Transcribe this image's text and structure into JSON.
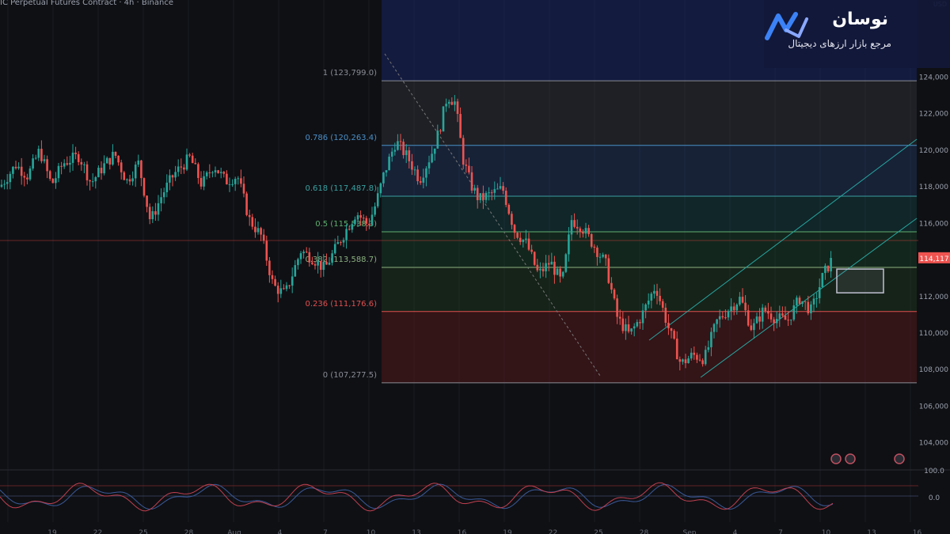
{
  "header": {
    "symbol_text": "IC Perpetual Futures Contract · 4h · Binance"
  },
  "brand": {
    "title": "نوسان",
    "subtitle": "مرجع بازار ارزهای دیجیتال"
  },
  "colors": {
    "up": "#26a69a",
    "down": "#ef5350",
    "bg": "#0f1014"
  },
  "chart_data": {
    "type": "candlestick",
    "currency_label": "USD",
    "y_ticks": [
      "124,000",
      "122,000",
      "120,000",
      "118,000",
      "116,000",
      "114,000",
      "112,000",
      "110,000",
      "108,000",
      "106,000",
      "104,000"
    ],
    "y_tick_values": [
      124000,
      122000,
      120000,
      118000,
      116000,
      114000,
      112000,
      110000,
      108000,
      106000,
      104000
    ],
    "ylim": [
      102600,
      126400
    ],
    "last_price": {
      "label": "114,117",
      "value": 114117
    },
    "fibonacci": [
      {
        "label": "1 (123,799.0)",
        "value": 123799.0
      },
      {
        "label": "0.786 (120,263.4)",
        "value": 120263.4
      },
      {
        "label": "0.618 (117,487.8)",
        "value": 117487.8
      },
      {
        "label": "0.5 (115,538.3)",
        "value": 115538.3
      },
      {
        "label": "0.382 (113,588.7)",
        "value": 113588.7
      },
      {
        "label": "0.236 (111,176.6)",
        "value": 111176.6
      },
      {
        "label": "0 (107,277.5)",
        "value": 107277.5
      }
    ],
    "close_path": [
      [
        0,
        118000
      ],
      [
        20,
        119200
      ],
      [
        35,
        118600
      ],
      [
        50,
        120000
      ],
      [
        65,
        118100
      ],
      [
        80,
        119300
      ],
      [
        100,
        119700
      ],
      [
        115,
        118200
      ],
      [
        130,
        119100
      ],
      [
        145,
        119800
      ],
      [
        160,
        118300
      ],
      [
        175,
        119300
      ],
      [
        190,
        116100
      ],
      [
        205,
        117600
      ],
      [
        220,
        118700
      ],
      [
        240,
        119600
      ],
      [
        255,
        118100
      ],
      [
        270,
        119200
      ],
      [
        285,
        118300
      ],
      [
        300,
        118600
      ],
      [
        315,
        116200
      ],
      [
        330,
        115300
      ],
      [
        345,
        112600
      ],
      [
        360,
        112100
      ],
      [
        380,
        114500
      ],
      [
        395,
        114100
      ],
      [
        410,
        113500
      ],
      [
        430,
        115100
      ],
      [
        450,
        116600
      ],
      [
        465,
        115900
      ],
      [
        475,
        117100
      ],
      [
        485,
        118700
      ],
      [
        500,
        120500
      ],
      [
        515,
        119600
      ],
      [
        530,
        118400
      ],
      [
        545,
        119800
      ],
      [
        555,
        121100
      ],
      [
        565,
        123000
      ],
      [
        575,
        122600
      ],
      [
        585,
        119500
      ],
      [
        595,
        118100
      ],
      [
        605,
        117300
      ],
      [
        620,
        117600
      ],
      [
        635,
        117900
      ],
      [
        650,
        115600
      ],
      [
        665,
        114900
      ],
      [
        680,
        113200
      ],
      [
        695,
        113900
      ],
      [
        710,
        112700
      ],
      [
        722,
        116200
      ],
      [
        735,
        115800
      ],
      [
        750,
        114800
      ],
      [
        765,
        113800
      ],
      [
        780,
        110800
      ],
      [
        795,
        109900
      ],
      [
        810,
        110900
      ],
      [
        828,
        112600
      ],
      [
        845,
        110200
      ],
      [
        860,
        108300
      ],
      [
        875,
        108800
      ],
      [
        890,
        108600
      ],
      [
        905,
        110600
      ],
      [
        920,
        111300
      ],
      [
        935,
        111900
      ],
      [
        950,
        110200
      ],
      [
        965,
        111300
      ],
      [
        980,
        110800
      ],
      [
        995,
        110700
      ],
      [
        1010,
        111900
      ],
      [
        1025,
        111200
      ],
      [
        1040,
        113200
      ],
      [
        1052,
        114100
      ]
    ],
    "prediction_box": {
      "y_top": 113500,
      "y_bottom": 112200
    },
    "oscillator_ticks": [
      "100.0",
      "0.0"
    ],
    "x_labels": [
      "19",
      "22",
      "25",
      "28",
      "Aug",
      "4",
      "7",
      "10",
      "13",
      "16",
      "19",
      "22",
      "25",
      "28",
      "Sep",
      "4",
      "7",
      "10",
      "13",
      "16"
    ]
  }
}
